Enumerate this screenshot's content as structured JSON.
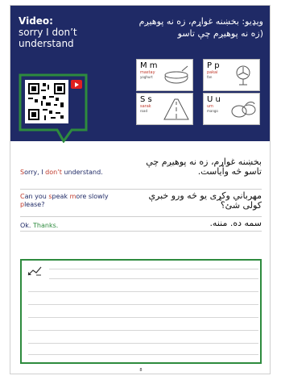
{
  "header": {
    "video_label": "Video:",
    "title_en": "sorry I don’t understand",
    "title_ps": "ويډيو: بخښنه غواړم، زه نه پوهيږم (زه نه پوهيږم چې تاسو"
  },
  "cards": [
    {
      "cap": "M m",
      "word": "mastay",
      "gloss": "yoghurt"
    },
    {
      "cap": "P p",
      "word": "pakai",
      "gloss": "fan"
    },
    {
      "cap": "S s",
      "word": "sarak",
      "gloss": "road"
    },
    {
      "cap": "U u",
      "word": "um",
      "gloss": "mango"
    }
  ],
  "phrases": [
    {
      "en_a": "S",
      "en_b": "orry, I ",
      "en_c": "don’t",
      "en_d": " understand.",
      "ps": "بخښنه غواړم، زه نه پوهيږم چې تاسو څه وایاست."
    },
    {
      "en_a": "C",
      "en_b": "an you ",
      "en_c": "s",
      "en_d": "peak ",
      "en_e": "m",
      "en_f": "ore slowly ",
      "en_g": "p",
      "en_h": "lease?",
      "ps": "مهرباني وکړی یو څه ورو خبرې کولی شئ؟"
    },
    {
      "en_a": "Ok. ",
      "en_b": "Thanks.",
      "ps": "سمه ده. مننه."
    }
  ],
  "page_number": "8",
  "colors": {
    "header_bg": "#1f2a66",
    "accent_red": "#c0392b",
    "box_green": "#2e8b3e"
  }
}
